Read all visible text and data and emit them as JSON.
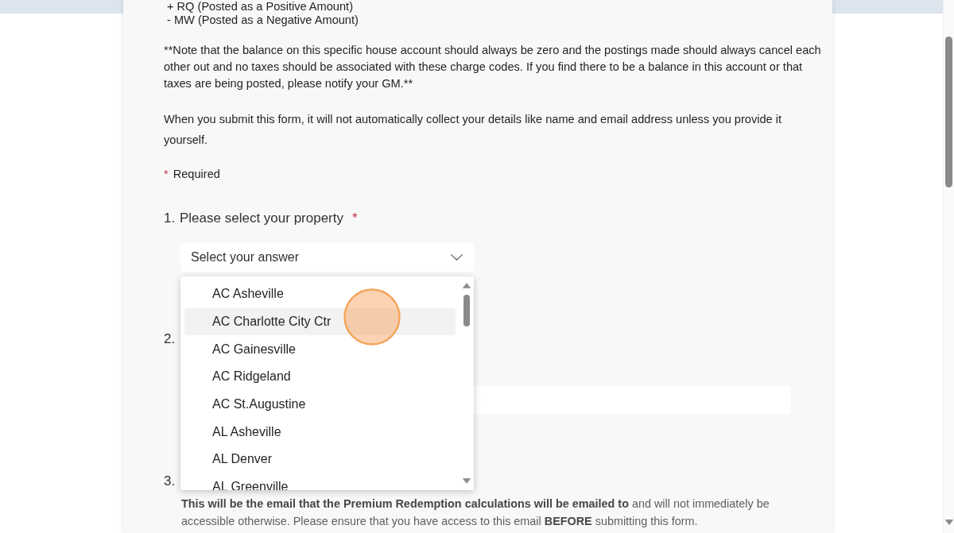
{
  "intro": {
    "lines": [
      "+ RQ (Posted as a Positive Amount)",
      "- MW (Posted as a Negative Amount)"
    ],
    "note": "**Note that the balance on this specific house account should always be zero and the postings made should always cancel each other out and no taxes should be associated with these charge codes. If you find there to be a balance in this account or that taxes are being posted, please notify your GM.**",
    "privacy_notice": "When you submit this form, it will not automatically collect your details like name and email address unless you provide it yourself."
  },
  "required_legend": {
    "mark": "*",
    "label": "Required"
  },
  "questions": [
    {
      "number": "1.",
      "title": "Please select your property",
      "required_mark": "*",
      "kind": "dropdown",
      "placeholder": "Select your answer",
      "expanded": true,
      "options": [
        {
          "label": "AC Asheville",
          "highlighted": false
        },
        {
          "label": "AC Charlotte City Ctr",
          "highlighted": true
        },
        {
          "label": "AC Gainesville",
          "highlighted": false
        },
        {
          "label": "AC Ridgeland",
          "highlighted": false
        },
        {
          "label": "AC St.Augustine",
          "highlighted": false
        },
        {
          "label": "AL Asheville",
          "highlighted": false
        },
        {
          "label": "AL Denver",
          "highlighted": false
        },
        {
          "label": "AL Greenville",
          "highlighted": false
        }
      ]
    },
    {
      "number": "2.",
      "kind": "text"
    },
    {
      "number": "3.",
      "kind": "description",
      "description": "**This will be the email that the Premium Redemption calculations will be emailed to** and will not immediately be accessible otherwise. Please ensure that you have access to this email **BEFORE** submitting this form."
    }
  ]
}
